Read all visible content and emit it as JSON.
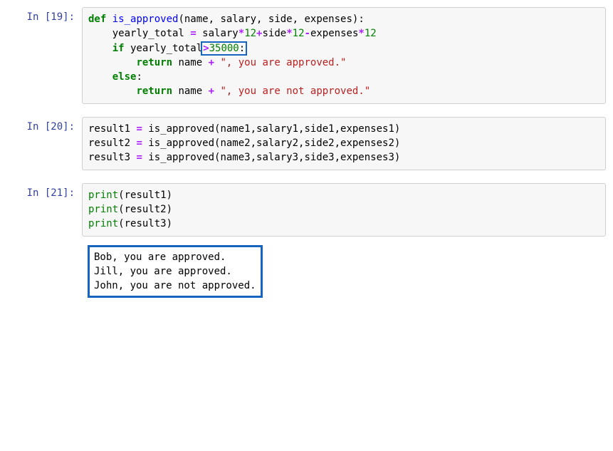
{
  "cells": [
    {
      "prompt": "In [19]:",
      "code": {
        "l1a": "def",
        "l1b": " ",
        "l1c": "is_approved",
        "l1d": "(name, salary, side, expenses):",
        "l2a": "    yearly_total ",
        "l2op1": "=",
        "l2b": " salary",
        "l2op2": "*",
        "l2n1": "12",
        "l2op3": "+",
        "l2c": "side",
        "l2op4": "*",
        "l2n2": "12",
        "l2op5": "-",
        "l2d": "expenses",
        "l2op6": "*",
        "l2n3": "12",
        "l3a": "    ",
        "l3kw": "if",
        "l3b": " yearly_total",
        "l3boxop": ">",
        "l3boxnum": "35000",
        "l3boxcolon": ":",
        "l4a": "        ",
        "l4kw": "return",
        "l4b": " name ",
        "l4op": "+",
        "l4c": " ",
        "l4str": "\", you are approved.\"",
        "l5a": "    ",
        "l5kw": "else",
        "l5b": ":",
        "l6a": "        ",
        "l6kw": "return",
        "l6b": " name ",
        "l6op": "+",
        "l6c": " ",
        "l6str": "\", you are not approved.\""
      }
    },
    {
      "prompt": "In [20]:",
      "code": {
        "l1a": "result1 ",
        "l1op": "=",
        "l1b": " is_approved(name1,salary1,side1,expenses1)",
        "l2a": "result2 ",
        "l2op": "=",
        "l2b": " is_approved(name2,salary2,side2,expenses2)",
        "l3a": "result3 ",
        "l3op": "=",
        "l3b": " is_approved(name3,salary3,side3,expenses3)"
      }
    },
    {
      "prompt": "In [21]:",
      "code": {
        "l1a": "print",
        "l1b": "(result1)",
        "l2a": "print",
        "l2b": "(result2)",
        "l3a": "print",
        "l3b": "(result3)"
      },
      "output": {
        "l1": "Bob, you are approved.",
        "l2": "Jill, you are approved.",
        "l3": "John, you are not approved."
      }
    }
  ]
}
